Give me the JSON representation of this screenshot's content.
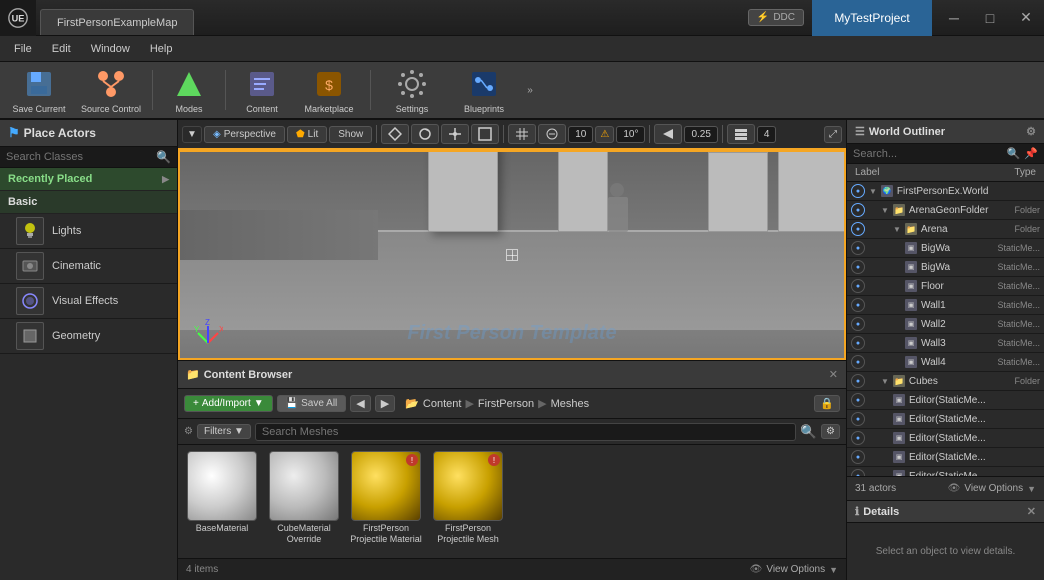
{
  "titlebar": {
    "project_name": "MyTestProject",
    "tab_label": "FirstPersonExampleMap",
    "ddc_label": "DDC"
  },
  "menu": {
    "items": [
      "File",
      "Edit",
      "Window",
      "Help"
    ]
  },
  "toolbar": {
    "buttons": [
      {
        "id": "save-current",
        "label": "Save Current",
        "icon": "save"
      },
      {
        "id": "source-control",
        "label": "Source Control",
        "icon": "source"
      },
      {
        "id": "modes",
        "label": "Modes",
        "icon": "modes"
      },
      {
        "id": "content",
        "label": "Content",
        "icon": "content"
      },
      {
        "id": "marketplace",
        "label": "Marketplace",
        "icon": "market"
      },
      {
        "id": "settings",
        "label": "Settings",
        "icon": "settings"
      },
      {
        "id": "blueprints",
        "label": "Blueprints",
        "icon": "bp"
      }
    ]
  },
  "left_panel": {
    "title": "Place Actors",
    "search_placeholder": "Search Classes",
    "categories": [
      {
        "id": "recently-placed",
        "label": "Recently Placed"
      },
      {
        "id": "basic",
        "label": "Basic"
      },
      {
        "id": "lights",
        "label": "Lights"
      },
      {
        "id": "cinematic",
        "label": "Cinematic"
      },
      {
        "id": "visual-effects",
        "label": "Visual Effects"
      },
      {
        "id": "geometry",
        "label": "Geometry"
      }
    ]
  },
  "viewport": {
    "perspective_label": "Perspective",
    "lit_label": "Lit",
    "show_label": "Show",
    "snap_value": "10",
    "angle_value": "10°",
    "scale_value": "0.25",
    "num_4": "4",
    "watermark": "First Person Template"
  },
  "content_browser": {
    "title": "Content Browser",
    "add_import_label": "Add/Import",
    "save_all_label": "Save All",
    "breadcrumb": [
      "Content",
      "FirstPerson",
      "Meshes"
    ],
    "search_placeholder": "Search Meshes",
    "filters_label": "Filters",
    "items_count": "4 items",
    "view_options_label": "View Options",
    "assets": [
      {
        "id": "base-material",
        "label": "BaseMaterial",
        "color": "#eee",
        "has_error": false,
        "type": "sphere_white"
      },
      {
        "id": "cube-material-override",
        "label": "CubeMaterial Override",
        "color": "#ddd",
        "has_error": false,
        "type": "sphere_white2"
      },
      {
        "id": "fp-projectile-material",
        "label": "FirstPerson Projectile Material",
        "color": "#c8a000",
        "has_error": true,
        "type": "sphere_gold"
      },
      {
        "id": "fp-projectile-mesh",
        "label": "FirstPerson Projectile Mesh",
        "color": "#c8a000",
        "has_error": true,
        "type": "sphere_gold2"
      }
    ]
  },
  "outliner": {
    "title": "World Outliner",
    "search_placeholder": "Search...",
    "col_label": "Label",
    "col_type": "Type",
    "footer_actors": "31 actors",
    "view_options_label": "View Options",
    "tree": [
      {
        "id": "world",
        "indent": 0,
        "label": "FirstPersonEx.World",
        "type": "",
        "arrow": "▼",
        "icon": "world"
      },
      {
        "id": "arena-folder",
        "indent": 1,
        "label": "ArenaGeon.Folder",
        "type": "Folder",
        "arrow": "▼",
        "icon": "folder"
      },
      {
        "id": "arena",
        "indent": 2,
        "label": "Arena",
        "type": "Folder",
        "arrow": "▼",
        "icon": "folder"
      },
      {
        "id": "bigwa1",
        "indent": 3,
        "label": "BigWa",
        "type": "StaticMe...",
        "arrow": "",
        "icon": "mesh"
      },
      {
        "id": "bigwa2",
        "indent": 3,
        "label": "BigWa",
        "type": "StaticMe...",
        "arrow": "",
        "icon": "mesh"
      },
      {
        "id": "floor",
        "indent": 3,
        "label": "Floor",
        "type": "StaticMe...",
        "arrow": "",
        "icon": "mesh"
      },
      {
        "id": "wall1",
        "indent": 3,
        "label": "Wall1",
        "type": "StaticMe...",
        "arrow": "",
        "icon": "mesh"
      },
      {
        "id": "wall2",
        "indent": 3,
        "label": "Wall2",
        "type": "StaticMe...",
        "arrow": "",
        "icon": "mesh"
      },
      {
        "id": "wall3",
        "indent": 3,
        "label": "Wall3",
        "type": "StaticMe...",
        "arrow": "",
        "icon": "mesh"
      },
      {
        "id": "wall4",
        "indent": 3,
        "label": "Wall4",
        "type": "StaticMe...",
        "arrow": "",
        "icon": "mesh"
      },
      {
        "id": "cubes-folder",
        "indent": 1,
        "label": "Cubes",
        "type": "Folder",
        "arrow": "▼",
        "icon": "folder"
      },
      {
        "id": "editor1",
        "indent": 2,
        "label": "Editor(StaticMe...",
        "type": "",
        "arrow": "",
        "icon": "mesh"
      },
      {
        "id": "editor2",
        "indent": 2,
        "label": "Editor(StaticMe...",
        "type": "",
        "arrow": "",
        "icon": "mesh"
      },
      {
        "id": "editor3",
        "indent": 2,
        "label": "Editor(StaticMe...",
        "type": "",
        "arrow": "",
        "icon": "mesh"
      },
      {
        "id": "editor4",
        "indent": 2,
        "label": "Editor(StaticMe...",
        "type": "",
        "arrow": "",
        "icon": "mesh"
      },
      {
        "id": "editor5",
        "indent": 2,
        "label": "Editor(StaticMe...",
        "type": "",
        "arrow": "",
        "icon": "mesh"
      }
    ]
  },
  "details": {
    "title": "Details",
    "body_text": "Select an object to view details."
  },
  "colors": {
    "accent_orange": "#f5a623",
    "toolbar_bg": "#3c3c3c",
    "panel_bg": "#2a2a2a",
    "header_bg": "#3a3a3a"
  }
}
